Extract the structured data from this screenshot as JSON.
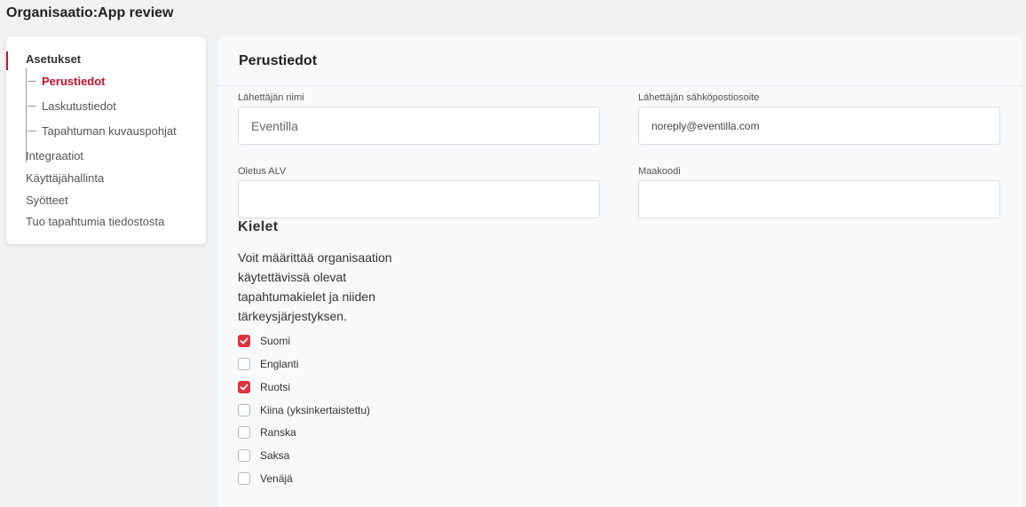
{
  "page": {
    "title": "Organisaatio:App review"
  },
  "sidebar": {
    "section": "Asetukset",
    "sub_items": [
      {
        "label": "Perustiedot",
        "active": true
      },
      {
        "label": "Laskutustiedot",
        "active": false
      },
      {
        "label": "Tapahtuman kuvauspohjat",
        "active": false
      }
    ],
    "items": [
      {
        "label": "Integraatiot"
      },
      {
        "label": "Käyttäjähallinta"
      },
      {
        "label": "Syötteet"
      },
      {
        "label": "Tuo tapahtumia tiedostosta"
      }
    ]
  },
  "main": {
    "title": "Perustiedot",
    "fields": {
      "sender_name": {
        "label": "Lähettäjän nimi",
        "value": "Eventilla"
      },
      "sender_email": {
        "label": "Lähettäjän sähköpostiosoite",
        "value": "noreply@eventilla.com"
      },
      "default_vat": {
        "label": "Oletus ALV",
        "value": ""
      },
      "country_code": {
        "label": "Maakoodi",
        "value": ""
      }
    },
    "languages": {
      "title": "Kielet",
      "description": "Voit määrittää organisaation käytettävissä olevat tapahtumakielet ja niiden tärkeysjärjestyksen.",
      "options": [
        {
          "label": "Suomi",
          "checked": true
        },
        {
          "label": "Englanti",
          "checked": false
        },
        {
          "label": "Ruotsi",
          "checked": true
        },
        {
          "label": "Kiina (yksinkertaistettu)",
          "checked": false
        },
        {
          "label": "Ranska",
          "checked": false
        },
        {
          "label": "Saksa",
          "checked": false
        },
        {
          "label": "Venäjä",
          "checked": false
        }
      ]
    }
  },
  "colors": {
    "accent": "#c8102e",
    "checkbox_checked": "#e03140"
  },
  "icons": {
    "checkbox_check": "check-icon"
  }
}
